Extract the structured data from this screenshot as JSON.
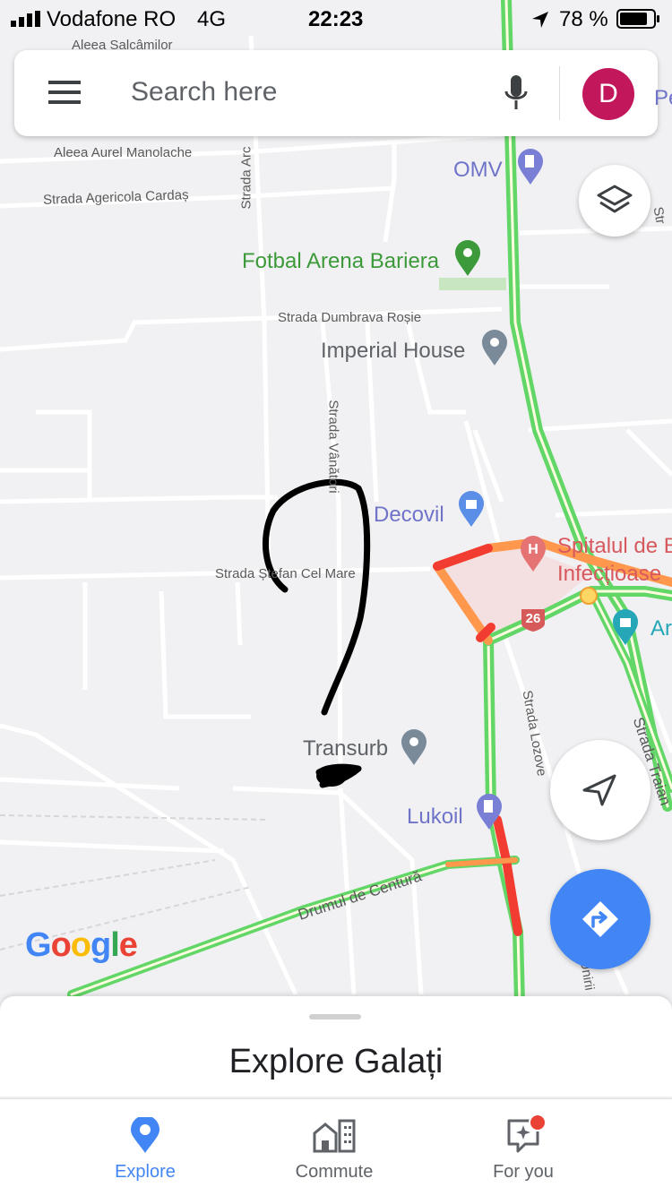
{
  "status_bar": {
    "carrier": "Vodafone RO",
    "network": "4G",
    "time": "22:23",
    "battery": "78 %"
  },
  "search": {
    "placeholder": "Search here",
    "avatar_initial": "D"
  },
  "map": {
    "streets": {
      "aleea_salcamilor": "Aleea Salcâmilor",
      "aleea_aurel": "Aleea Aurel Manolache",
      "strada_agericola": "Strada Agericola Cardaș",
      "strada_arc": "Strada Arc",
      "strada_dumbrava": "Strada Dumbrava Roșie",
      "strada_vanatori": "Strada Vânători",
      "strada_stefan": "Strada Ștefan Cel Mare",
      "strada_lozova": "Strada Lozove",
      "strada_traian": "Strada Traian",
      "drumul_centura": "Drumul de Centură",
      "unirii": "Unirii",
      "str_edge": "Str"
    },
    "pois": {
      "omv": "OMV",
      "fotbal": "Fotbal Arena Bariera",
      "imperial": "Imperial House",
      "decovil": "Decovil",
      "spital_line1": "Spitalul de B",
      "spital_line2": "Infecțioase",
      "transurb": "Transurb",
      "lukoil": "Lukoil",
      "ar": "Ar",
      "pe": "Pe"
    },
    "route_shield": "26",
    "google_logo": "Google"
  },
  "bottom_sheet": {
    "title": "Explore Galați"
  },
  "nav": {
    "explore": "Explore",
    "commute": "Commute",
    "for_you": "For you"
  },
  "colors": {
    "accent": "#4285f4",
    "traffic_green": "#63d668",
    "traffic_orange": "#ff974d",
    "traffic_red": "#f23c32",
    "poi_green": "#3d9a3a",
    "poi_gray": "#5f6368",
    "poi_purple": "#6f74c9"
  }
}
